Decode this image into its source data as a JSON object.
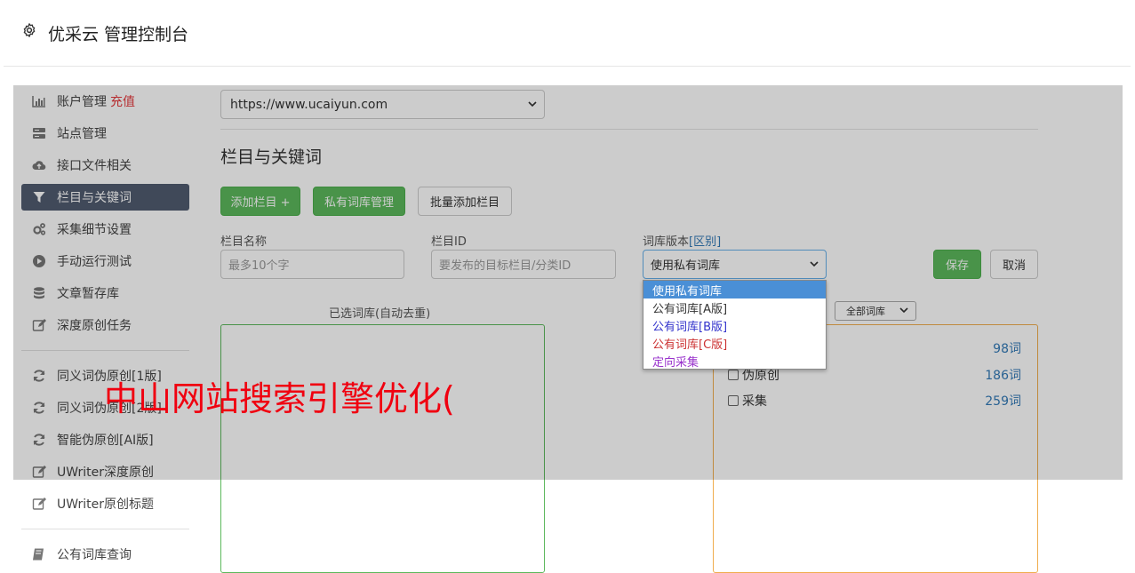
{
  "header": {
    "title": "优采云 管理控制台",
    "icon": "gear-icon"
  },
  "sidebar": {
    "items": [
      {
        "label": "账户管理",
        "extra": "充值",
        "icon": "bar-chart-icon"
      },
      {
        "label": "站点管理",
        "icon": "server-icon"
      },
      {
        "label": "接口文件相关",
        "icon": "cloud-upload-icon"
      },
      {
        "label": "栏目与关键词",
        "icon": "filter-icon",
        "active": true
      },
      {
        "label": "采集细节设置",
        "icon": "cogs-icon"
      },
      {
        "label": "手动运行测试",
        "icon": "play-circle-icon"
      },
      {
        "label": "文章暂存库",
        "icon": "database-icon"
      },
      {
        "label": "深度原创任务",
        "icon": "edit-icon"
      },
      {
        "label": "同义词伪原创[1版]",
        "icon": "refresh-icon"
      },
      {
        "label": "同义词伪原创[2版]",
        "icon": "refresh-icon"
      },
      {
        "label": "智能伪原创[AI版]",
        "icon": "refresh-icon"
      },
      {
        "label": "UWriter深度原创",
        "icon": "edit-icon"
      },
      {
        "label": "UWriter原创标题",
        "icon": "edit-icon"
      },
      {
        "label": "公有词库查询",
        "icon": "book-icon"
      }
    ]
  },
  "main": {
    "site_select": "https://www.ucaiyun.com",
    "section_title": "栏目与关键词",
    "buttons": {
      "add_column": "添加栏目 +",
      "private_lib": "私有词库管理",
      "batch_add": "批量添加栏目"
    },
    "form": {
      "name_label": "栏目名称",
      "name_placeholder": "最多10个字",
      "id_label": "栏目ID",
      "id_placeholder": "要发布的目标栏目/分类ID",
      "version_label": "词库版本",
      "version_link": "[区别]",
      "version_value": "使用私有词库",
      "save": "保存",
      "cancel": "取消"
    },
    "version_options": [
      {
        "label": "使用私有词库",
        "color": "#ffffff",
        "selected": true
      },
      {
        "label": "公有词库[A版]",
        "color": "#333333"
      },
      {
        "label": "公有词库[B版]",
        "color": "#3333cc"
      },
      {
        "label": "公有词库[C版]",
        "color": "#cc3333"
      },
      {
        "label": "定向采集",
        "color": "#9933cc"
      }
    ],
    "selected_box_title": "已选词库(自动去重)",
    "lib_filter": "全部词库",
    "libraries": [
      {
        "name": "",
        "count": "98词"
      },
      {
        "name": "伪原创",
        "count": "186词"
      },
      {
        "name": "采集",
        "count": "259词"
      }
    ]
  },
  "watermark": "中山网站搜索引擎优化("
}
